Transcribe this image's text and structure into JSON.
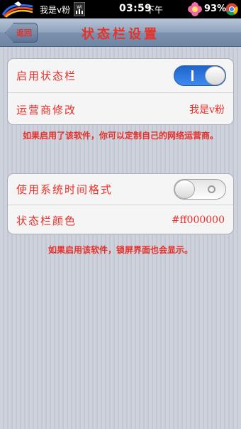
{
  "status_bar": {
    "carrier": "我是v粉",
    "time": "03:59",
    "time_suffix": "下午",
    "battery": "93%",
    "icons": [
      "horse-logo-icon",
      "wifi-icon",
      "flower-icon",
      "chrome-icon"
    ]
  },
  "nav": {
    "back_label": "返回",
    "title": "状态栏设置"
  },
  "group1": {
    "enable_label": "启用状态栏",
    "enable_on": true,
    "carrier_label": "运营商修改",
    "carrier_value": "我是v粉"
  },
  "note1": "如果启用了该软件，你可以定制自己的网络运营商。",
  "group2": {
    "system_time_label": "使用系统时间格式",
    "system_time_on": false,
    "color_label": "状态栏颜色",
    "color_value": "#ff000000"
  },
  "note2": "如果启用该软件，锁屏界面也会显示。",
  "colors": {
    "text_red": "#e8302a",
    "switch_on": "#2f7be6",
    "navbar": "#8fa3bd",
    "statusbar": "#000000"
  }
}
